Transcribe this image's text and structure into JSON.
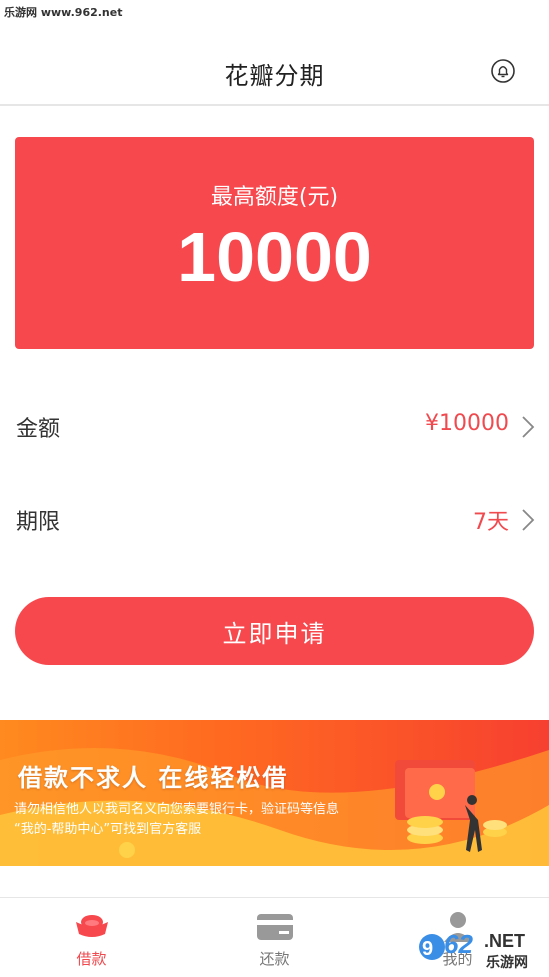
{
  "watermark_top": "乐游网 www.962.net",
  "header": {
    "title": "花瓣分期"
  },
  "quota": {
    "label": "最高额度(元)",
    "value": "10000"
  },
  "form": {
    "amount": {
      "label": "金额",
      "value": "¥10000"
    },
    "term": {
      "label": "期限",
      "value": "7天"
    }
  },
  "apply_button": "立即申请",
  "banner": {
    "title": "借款不求人 在线轻松借",
    "line1": "请勿相信他人以我司名义向您索要银行卡，验证码等信息",
    "line2": "“我的-帮助中心”可找到官方客服"
  },
  "tabs": [
    {
      "label": "借款",
      "icon": "ingot-icon",
      "active": true
    },
    {
      "label": "还款",
      "icon": "card-icon",
      "active": false
    },
    {
      "label": "我的",
      "icon": "user-icon",
      "active": false
    }
  ],
  "brand_watermark": {
    "number": "962",
    "suffix": ".NET",
    "sub": "乐游网"
  },
  "colors": {
    "accent": "#f7484e",
    "text_red": "#f04a4f",
    "banner_orange": "#ff8a1f"
  }
}
